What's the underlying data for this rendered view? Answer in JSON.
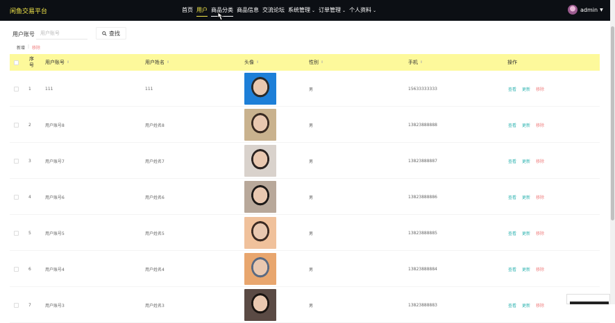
{
  "header": {
    "brand": "闲鱼交易平台",
    "nav": [
      {
        "label": "首页",
        "dropdown": false
      },
      {
        "label": "用户",
        "dropdown": false,
        "active": true
      },
      {
        "label": "商品分类",
        "dropdown": false
      },
      {
        "label": "商品信息",
        "dropdown": false
      },
      {
        "label": "交流论坛",
        "dropdown": false
      },
      {
        "label": "系统管理",
        "dropdown": true
      },
      {
        "label": "订单管理",
        "dropdown": true
      },
      {
        "label": "个人资料",
        "dropdown": true
      }
    ],
    "user": "admin"
  },
  "search": {
    "label": "用户账号",
    "placeholder": "用户账号",
    "button": "查找"
  },
  "actions": {
    "add": "新增",
    "delete": "移除"
  },
  "table": {
    "columns": {
      "index": "序号",
      "account": "用户账号",
      "name": "用户姓名",
      "avatar": "头像",
      "gender": "性别",
      "phone": "手机",
      "ops": "操作"
    },
    "row_ops": {
      "view": "查看",
      "edit": "更新",
      "delete": "移除"
    },
    "rows": [
      {
        "index": "1",
        "account": "111",
        "name": "111",
        "gender": "男",
        "phone": "15633333333",
        "avatar_colors": [
          "#1d7fd8",
          "#2a2a2a"
        ]
      },
      {
        "index": "2",
        "account": "用户账号8",
        "name": "用户姓名8",
        "gender": "男",
        "phone": "13823888888",
        "avatar_colors": [
          "#c9b28e",
          "#3a2b22"
        ]
      },
      {
        "index": "3",
        "account": "用户账号7",
        "name": "用户姓名7",
        "gender": "男",
        "phone": "13823888887",
        "avatar_colors": [
          "#d9d2cc",
          "#2c2422"
        ]
      },
      {
        "index": "4",
        "account": "用户账号6",
        "name": "用户姓名6",
        "gender": "男",
        "phone": "13823888886",
        "avatar_colors": [
          "#b8a89a",
          "#1e1a18"
        ]
      },
      {
        "index": "5",
        "account": "用户账号5",
        "name": "用户姓名5",
        "gender": "男",
        "phone": "13823888885",
        "avatar_colors": [
          "#f0c19b",
          "#3d2c24"
        ]
      },
      {
        "index": "6",
        "account": "用户账号4",
        "name": "用户姓名4",
        "gender": "男",
        "phone": "13823888884",
        "avatar_colors": [
          "#e8a66e",
          "#5a6a82"
        ]
      },
      {
        "index": "7",
        "account": "用户账号3",
        "name": "用户姓名3",
        "gender": "男",
        "phone": "13823888883",
        "avatar_colors": [
          "#5a4a44",
          "#1a1512"
        ]
      }
    ]
  }
}
